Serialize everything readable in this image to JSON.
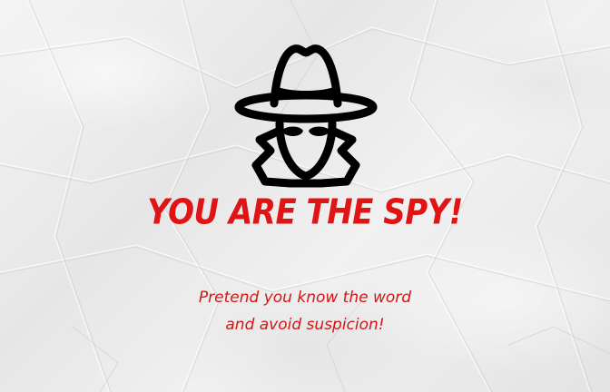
{
  "screen": {
    "icon": "spy-icon",
    "title": "YOU ARE THE SPY!",
    "message_line1": "Pretend you know the word",
    "message_line2": "and avoid suspicion!"
  },
  "colors": {
    "accent": "#e01414",
    "icon": "#000000",
    "paper": "#ececec"
  }
}
